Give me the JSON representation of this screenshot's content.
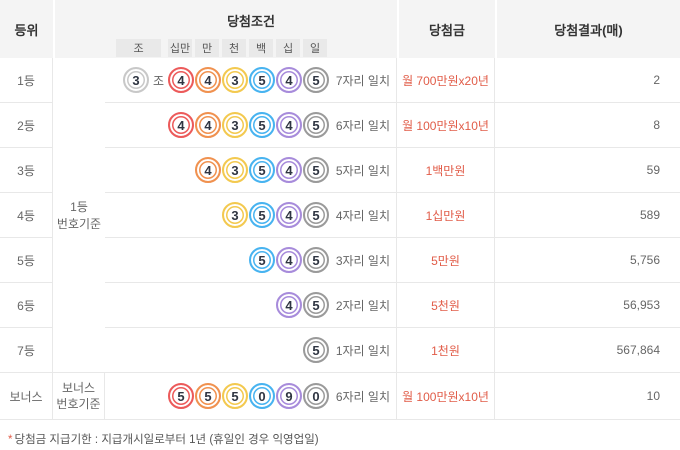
{
  "colors": {
    "accent_prize": "#e15c48",
    "header_bg": "#f4f4f4",
    "border": "#e8e8e8",
    "ball_jo": "#c8c8c8",
    "ball_sipman": "#ec5a5a",
    "ball_man": "#f0914f",
    "ball_cheon": "#f3c94f",
    "ball_baek": "#47b3f0",
    "ball_sip": "#a78bdb",
    "ball_il": "#9a9a9a"
  },
  "table": {
    "header": {
      "rank": "등위",
      "condition": "당첨조건",
      "prize": "당첨금",
      "result": "당첨결과(매)"
    },
    "units": [
      "조",
      "십만",
      "만",
      "천",
      "백",
      "십",
      "일"
    ],
    "merged_basis": {
      "line1": "1등",
      "line2": "번호기준"
    },
    "rows": [
      {
        "rank": "1등",
        "group": "3",
        "group_label": "조",
        "balls": [
          "4",
          "4",
          "3",
          "5",
          "4",
          "5"
        ],
        "match": "7자리 일치",
        "prize": "월 700만원x20년",
        "count": "2"
      },
      {
        "rank": "2등",
        "balls": [
          "4",
          "4",
          "3",
          "5",
          "4",
          "5"
        ],
        "match": "6자리 일치",
        "prize": "월 100만원x10년",
        "count": "8"
      },
      {
        "rank": "3등",
        "balls": [
          "4",
          "3",
          "5",
          "4",
          "5"
        ],
        "match": "5자리 일치",
        "prize": "1백만원",
        "count": "59"
      },
      {
        "rank": "4등",
        "balls": [
          "3",
          "5",
          "4",
          "5"
        ],
        "match": "4자리 일치",
        "prize": "1십만원",
        "count": "589"
      },
      {
        "rank": "5등",
        "balls": [
          "5",
          "4",
          "5"
        ],
        "match": "3자리 일치",
        "prize": "5만원",
        "count": "5,756"
      },
      {
        "rank": "6등",
        "balls": [
          "4",
          "5"
        ],
        "match": "2자리 일치",
        "prize": "5천원",
        "count": "56,953"
      },
      {
        "rank": "7등",
        "balls": [
          "5"
        ],
        "match": "1자리 일치",
        "prize": "1천원",
        "count": "567,864"
      },
      {
        "rank": "보너스",
        "basis": {
          "line1": "보너스",
          "line2": "번호기준"
        },
        "balls": [
          "5",
          "5",
          "5",
          "0",
          "9",
          "0"
        ],
        "match": "6자리 일치",
        "prize": "월 100만원x10년",
        "count": "10"
      }
    ]
  },
  "footnote": {
    "mark": "*",
    "text": "당첨금 지급기한 : 지급개시일로부터 1년 (휴일인 경우 익영업일)"
  }
}
